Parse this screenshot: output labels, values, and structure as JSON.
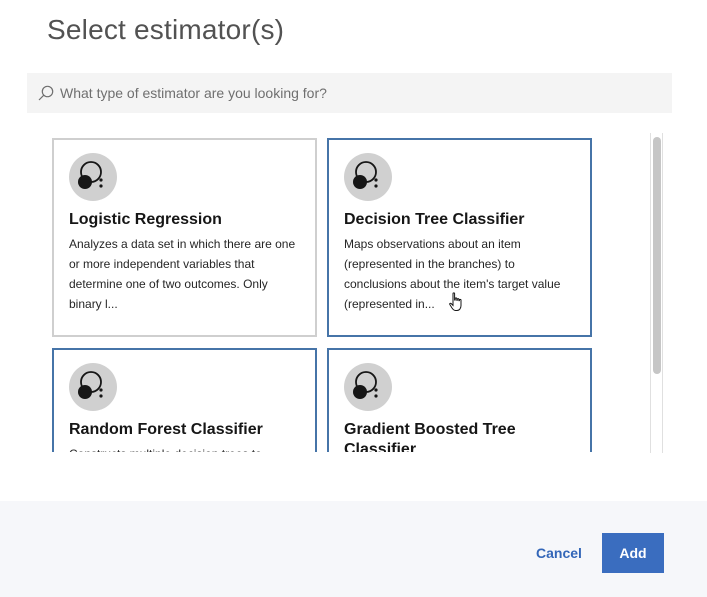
{
  "dialog": {
    "title": "Select estimator(s)"
  },
  "search": {
    "placeholder": "What type of estimator are you looking for?",
    "value": "",
    "icon": "search-icon"
  },
  "estimators": [
    {
      "name": "Logistic Regression",
      "description": "Analyzes a data set in which there are one or more independent variables that determine one of two outcomes. Only binary l...",
      "icon": "estimator-icon",
      "selected": false
    },
    {
      "name": "Decision Tree Classifier",
      "description": "Maps observations about an item (represented in the branches) to conclusions about the item's target value (represented in...",
      "icon": "estimator-icon",
      "selected": true
    },
    {
      "name": "Random Forest Classifier",
      "description": "Constructs multiple decision trees to",
      "icon": "estimator-icon",
      "selected": true
    },
    {
      "name": "Gradient Boosted Tree Classifier",
      "description": "",
      "icon": "estimator-icon",
      "selected": true
    }
  ],
  "footer": {
    "cancel_label": "Cancel",
    "add_label": "Add"
  },
  "colors": {
    "accent": "#3a6dbf",
    "selected_border": "#4674a8",
    "badge_bg": "#d0d0d0",
    "footer_bg": "#f6f7fa"
  }
}
